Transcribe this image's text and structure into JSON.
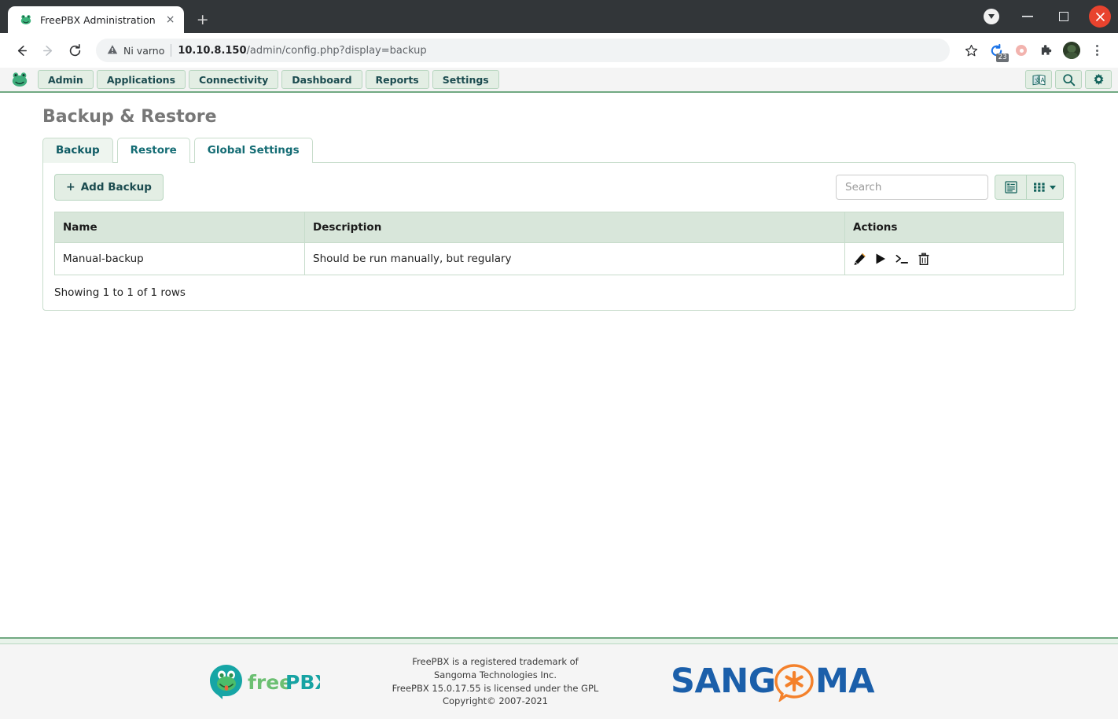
{
  "browser": {
    "tab": {
      "title": "FreePBX Administration",
      "favicon": "frog-favicon",
      "close": "×"
    },
    "new_tab_label": "+",
    "window_controls": {
      "dropdown": "▼",
      "minimize": "—",
      "maximize": "□",
      "close": "✕"
    },
    "nav": {
      "back": "←",
      "forward": "→",
      "reload": "↻"
    },
    "omnibox": {
      "security_label": "Ni varno",
      "url_host": "10.10.8.150",
      "url_path": "/admin/config.php?display=backup",
      "bookmark_icon": "star-icon"
    },
    "extensions": {
      "badge_count": "23",
      "record_icon": "record-dot-icon",
      "puzzle_icon": "extensions-icon",
      "profile_icon": "avatar",
      "menu_icon": "kebab-menu-icon"
    }
  },
  "fpbx_nav": {
    "logo": "freepbx-frog-logo",
    "items": [
      {
        "label": "Admin"
      },
      {
        "label": "Applications"
      },
      {
        "label": "Connectivity"
      },
      {
        "label": "Dashboard"
      },
      {
        "label": "Reports"
      },
      {
        "label": "Settings"
      }
    ],
    "right_icons": [
      {
        "name": "language-icon"
      },
      {
        "name": "search-icon"
      },
      {
        "name": "gear-icon"
      }
    ]
  },
  "page": {
    "title": "Backup & Restore",
    "tabs": [
      {
        "label": "Backup",
        "active": true
      },
      {
        "label": "Restore",
        "active": false
      },
      {
        "label": "Global Settings",
        "active": false
      }
    ]
  },
  "toolbar": {
    "add_backup_label": "Add Backup",
    "add_backup_plus": "+",
    "search_placeholder": "Search",
    "search_value": "",
    "list_view_icon": "list-view-icon",
    "columns_icon": "columns-grid-icon"
  },
  "table": {
    "columns": [
      "Name",
      "Description",
      "Actions"
    ],
    "rows": [
      {
        "name": "Manual-backup",
        "description": "Should be run manually, but regulary",
        "actions": [
          "edit-pencil-icon",
          "run-play-icon",
          "terminal-icon",
          "delete-trash-icon"
        ]
      }
    ],
    "showing": "Showing 1 to 1 of 1 rows"
  },
  "footer": {
    "logo": "freepbx-logo",
    "line1": "FreePBX is a registered trademark of",
    "line2": "Sangoma Technologies Inc.",
    "line3": "FreePBX 15.0.17.55 is licensed under the GPL",
    "line4": "Copyright© 2007-2021",
    "sangoma_logo": "sangoma-logo"
  },
  "colors": {
    "nav_green_border": "#71a982",
    "button_bg": "#e3eee4",
    "table_header_bg": "#d8e6da",
    "link_teal": "#146c74",
    "title_grey": "#777777",
    "sangoma_blue": "#1b5faa",
    "sangoma_orange": "#f4812b",
    "freepbx_teal": "#15a0a0",
    "freepbx_green": "#5cb85c",
    "close_red": "#e8432e"
  }
}
